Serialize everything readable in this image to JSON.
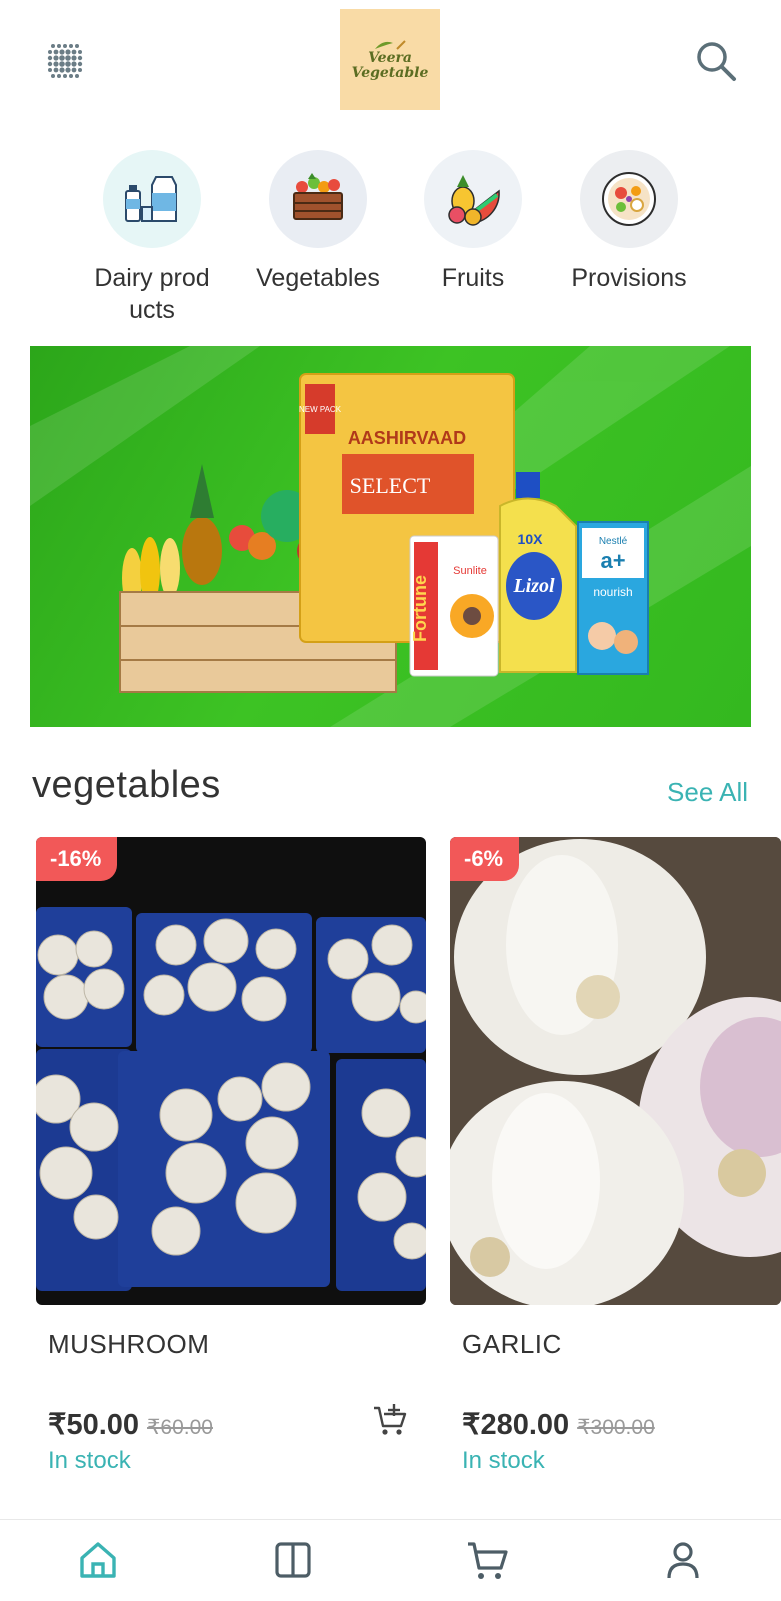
{
  "app": {
    "logo_line1": "Veera",
    "logo_line2": "Vegetable"
  },
  "categories": [
    {
      "label": "Dairy products",
      "icon": "dairy-products-icon",
      "bg": "#e6f6f6"
    },
    {
      "label": "Vegetables",
      "icon": "vegetables-crate-icon",
      "bg": "#e9edf3"
    },
    {
      "label": "Fruits",
      "icon": "fruits-icon",
      "bg": "#eef2f6"
    },
    {
      "label": "Provisions",
      "icon": "provisions-bowl-icon",
      "bg": "#eceef1"
    }
  ],
  "banner": {
    "brand_text": "AASHIRVAAD",
    "product_text": "SELECT",
    "tag_text": "NEW PACK",
    "oil_brand": "Fortune",
    "oil_sub": "Sunlite",
    "cleaner_text": "Lizol",
    "cleaner_tag": "10X",
    "milk_brand": "Nestlé",
    "milk_product": "a+",
    "milk_sub": "nourish"
  },
  "section": {
    "title": "vegetables",
    "see_all": "See All"
  },
  "products": [
    {
      "name": "MUSHROOM",
      "discount": "-16%",
      "price": "₹50.00",
      "old_price": "₹60.00",
      "stock": "In stock"
    },
    {
      "name": "GARLIC",
      "discount": "-6%",
      "price": "₹280.00",
      "old_price": "₹300.00",
      "stock": "In stock"
    }
  ],
  "nav": [
    "home-icon",
    "catalog-icon",
    "cart-icon",
    "profile-icon"
  ],
  "colors": {
    "accent": "#3ab3b3",
    "badge": "#f25858",
    "banner_green": "#3dc324",
    "logo_bg": "#f9dba6"
  }
}
